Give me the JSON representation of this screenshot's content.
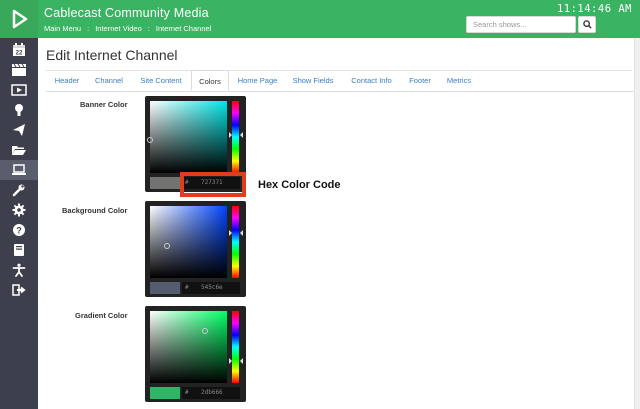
{
  "app": {
    "title": "Cablecast Community Media",
    "clock": "11:14:46 AM"
  },
  "breadcrumb": [
    "Main Menu",
    "Internet Video",
    "Internet Channel"
  ],
  "breadcrumb_sep": ":",
  "search": {
    "placeholder": "Search shows..."
  },
  "sidebar": {
    "active_index": 6,
    "items": [
      {
        "icon": "calendar-icon"
      },
      {
        "icon": "clapperboard-icon"
      },
      {
        "icon": "video-screen-icon"
      },
      {
        "icon": "podcast-icon"
      },
      {
        "icon": "paper-plane-icon"
      },
      {
        "icon": "folder-open-icon"
      },
      {
        "icon": "laptop-icon"
      },
      {
        "icon": "wrench-icon"
      },
      {
        "icon": "gear-icon"
      },
      {
        "icon": "question-icon"
      },
      {
        "icon": "book-icon"
      },
      {
        "icon": "accessibility-icon"
      },
      {
        "icon": "sign-out-icon"
      }
    ]
  },
  "page": {
    "title": "Edit Internet Channel"
  },
  "tabs": [
    {
      "label": "Header"
    },
    {
      "label": "Channel"
    },
    {
      "label": "Site Content"
    },
    {
      "label": "Colors",
      "active": true
    },
    {
      "label": "Home Page"
    },
    {
      "label": "Show Fields"
    },
    {
      "label": "Contact Info"
    },
    {
      "label": "Footer"
    },
    {
      "label": "Metrics"
    }
  ],
  "colors": {
    "banner": {
      "label": "Banner Color",
      "hex": "727371",
      "hue_color": "#00e5e5",
      "swatch": "#727371"
    },
    "background": {
      "label": "Background Color",
      "hex": "545c6e",
      "hue_color": "#0044ff",
      "swatch": "#545c6e"
    },
    "gradient": {
      "label": "Gradient Color",
      "hex": "2db666",
      "hue_color": "#00ff66",
      "swatch": "#2db666"
    }
  },
  "annotation": {
    "label": "Hex Color Code",
    "color": "#e53b1d"
  },
  "theme": {
    "header_green": "#3ab463",
    "sidebar": "#3d3f4c",
    "link_blue": "#3a7fc1"
  }
}
